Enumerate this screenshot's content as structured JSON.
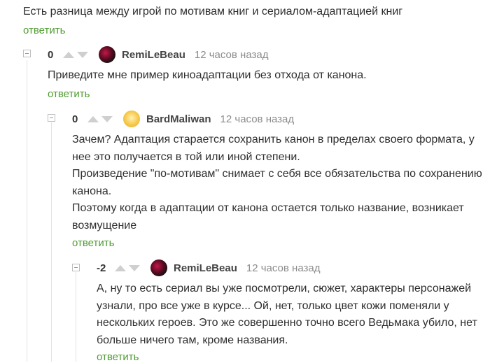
{
  "root": {
    "text": "Есть разница между игрой по мотивам книг и сериалом-адаптацией книг",
    "reply_label": "ответить"
  },
  "comments": [
    {
      "rating": "0",
      "author": "RemiLeBeau",
      "time": "12 часов назад",
      "avatar_icon": "remi-avatar",
      "paragraphs": [
        "Приведите мне пример киноадаптации без отхода от канона."
      ],
      "reply_label": "ответить"
    },
    {
      "rating": "0",
      "author": "BardMaliwan",
      "time": "12 часов назад",
      "avatar_icon": "bard-avatar",
      "paragraphs": [
        "Зачем? Адаптация старается сохранить канон в пределах своего формата, у нее это получается в той или иной степени.",
        "Произведение \"по-мотивам\" снимает с себя все обязательства по сохранению канона.",
        "Поэтому когда в адаптации от канона остается только название, возникает возмущение"
      ],
      "reply_label": "ответить"
    },
    {
      "rating": "-2",
      "author": "RemiLeBeau",
      "time": "12 часов назад",
      "avatar_icon": "remi-avatar",
      "paragraphs": [
        "А, ну то есть сериал вы уже посмотрели, сюжет, характеры персонажей узнали, про все уже в курсе... Ой, нет, только цвет кожи поменяли у нескольких героев. Это же совершенно точно всего Ведьмака убило, нет больше ничего там, кроме названия."
      ],
      "reply_label": "ответить"
    }
  ]
}
